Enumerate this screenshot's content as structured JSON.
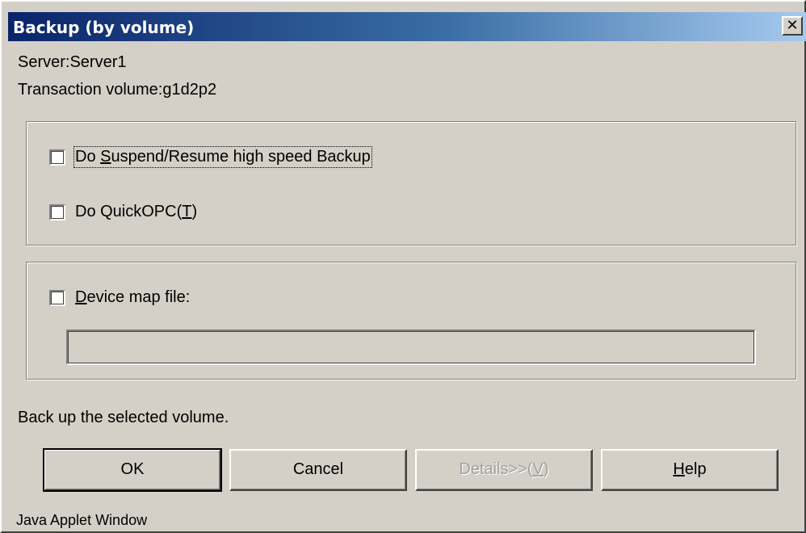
{
  "window": {
    "title": "Backup (by volume)",
    "close_glyph": "✕"
  },
  "info": {
    "server": "Server:Server1",
    "volume": "Transaction volume:g1d2p2"
  },
  "options": {
    "suspend": {
      "prefix": "Do ",
      "mnemonic": "S",
      "suffix": "uspend/Resume high speed Backup",
      "checked": false
    },
    "quickopc": {
      "label": "Do QuickOPC(",
      "mnemonic": "T",
      "suffix": ")",
      "checked": false
    }
  },
  "device_map": {
    "mnemonic": "D",
    "suffix": "evice map file:",
    "checked": false,
    "path_value": ""
  },
  "message": "Back up the selected volume.",
  "buttons": {
    "ok": "OK",
    "cancel": "Cancel",
    "details_prefix": "Details>>(",
    "details_mnemonic": "V",
    "details_suffix": ")",
    "help_mnemonic": "H",
    "help_suffix": "elp"
  },
  "footer": "Java Applet Window"
}
